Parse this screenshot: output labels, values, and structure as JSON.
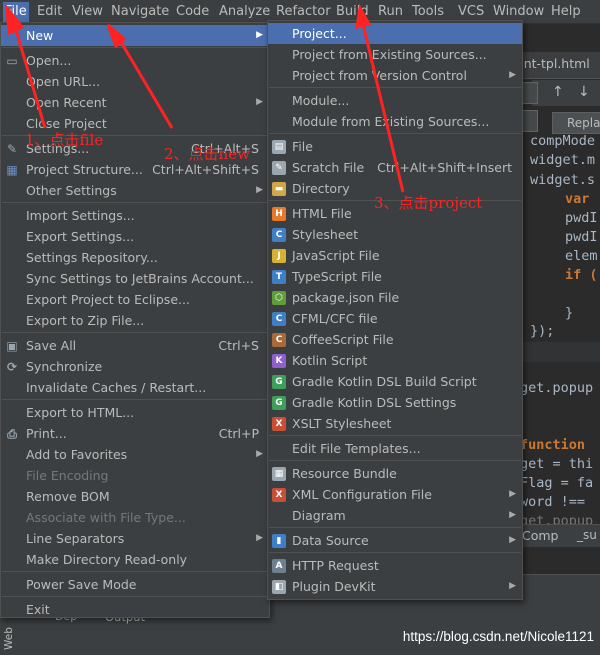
{
  "menubar": {
    "items": [
      "File",
      "Edit",
      "View",
      "Navigate",
      "Code",
      "Analyze",
      "Refactor",
      "Build",
      "Run",
      "Tools",
      "VCS",
      "Window",
      "Help"
    ]
  },
  "editor": {
    "tab_title": "ent-tpl.html",
    "replace_button": "Replac",
    "code_lines": [
      "compMode",
      "widget.m",
      "widget.s",
      "var",
      "pwdI",
      "pwdI",
      "elem",
      "if (",
      "}",
      "});",
      "get.popup",
      "function",
      "get = thi",
      "Flag = fa",
      "word !==",
      "get.popup"
    ],
    "breadcrumb": [
      "Comp",
      "_su"
    ],
    "bottom_panel": {
      "left_label": "Dep",
      "output_label": "Output",
      "side_tab": "Web"
    }
  },
  "file_menu": {
    "items": [
      {
        "label": "New",
        "arrow": true,
        "selected": true
      },
      {
        "label": "Open...",
        "sep_before": true
      },
      {
        "label": "Open URL..."
      },
      {
        "label": "Open Recent",
        "arrow": true
      },
      {
        "label": "Close Project"
      },
      {
        "label": "Settings...",
        "shortcut": "Ctrl+Alt+S",
        "sep_before": true
      },
      {
        "label": "Project Structure...",
        "shortcut": "Ctrl+Alt+Shift+S"
      },
      {
        "label": "Other Settings",
        "arrow": true
      },
      {
        "label": "Import Settings...",
        "sep_before": true
      },
      {
        "label": "Export Settings..."
      },
      {
        "label": "Settings Repository..."
      },
      {
        "label": "Sync Settings to JetBrains Account..."
      },
      {
        "label": "Export Project to Eclipse..."
      },
      {
        "label": "Export to Zip File..."
      },
      {
        "label": "Save All",
        "shortcut": "Ctrl+S",
        "sep_before": true
      },
      {
        "label": "Synchronize"
      },
      {
        "label": "Invalidate Caches / Restart..."
      },
      {
        "label": "Export to HTML...",
        "sep_before": true
      },
      {
        "label": "Print...",
        "shortcut": "Ctrl+P"
      },
      {
        "label": "Add to Favorites",
        "arrow": true
      },
      {
        "label": "File Encoding",
        "disabled": true
      },
      {
        "label": "Remove BOM"
      },
      {
        "label": "Associate with File Type...",
        "disabled": true
      },
      {
        "label": "Line Separators",
        "arrow": true
      },
      {
        "label": "Make Directory Read-only"
      },
      {
        "label": "Power Save Mode",
        "sep_before": true
      },
      {
        "label": "Exit",
        "sep_before": true
      }
    ]
  },
  "new_menu": {
    "items": [
      {
        "label": "Project...",
        "selected": true
      },
      {
        "label": "Project from Existing Sources..."
      },
      {
        "label": "Project from Version Control",
        "arrow": true
      },
      {
        "label": "Module...",
        "sep_before": true
      },
      {
        "label": "Module from Existing Sources..."
      },
      {
        "label": "File",
        "icon": "file-icon",
        "sep_before": true
      },
      {
        "label": "Scratch File",
        "shortcut": "Ctrl+Alt+Shift+Insert",
        "icon": "scratch-file-icon"
      },
      {
        "label": "Directory",
        "icon": "folder-icon"
      },
      {
        "label": "HTML File",
        "icon": "html-file-icon",
        "sep_before": true
      },
      {
        "label": "Stylesheet",
        "icon": "css-file-icon"
      },
      {
        "label": "JavaScript File",
        "icon": "js-file-icon"
      },
      {
        "label": "TypeScript File",
        "icon": "ts-file-icon"
      },
      {
        "label": "package.json File",
        "icon": "nodejs-icon"
      },
      {
        "label": "CFML/CFC file",
        "icon": "cfml-file-icon"
      },
      {
        "label": "CoffeeScript File",
        "icon": "coffeescript-icon"
      },
      {
        "label": "Kotlin Script",
        "icon": "kotlin-icon"
      },
      {
        "label": "Gradle Kotlin DSL Build Script",
        "icon": "gradle-icon"
      },
      {
        "label": "Gradle Kotlin DSL Settings",
        "icon": "gradle-icon"
      },
      {
        "label": "XSLT Stylesheet",
        "icon": "xslt-file-icon"
      },
      {
        "label": "Edit File Templates...",
        "sep_before": true
      },
      {
        "label": "Resource Bundle",
        "icon": "resource-bundle-icon",
        "sep_before": true
      },
      {
        "label": "XML Configuration File",
        "arrow": true,
        "icon": "xml-file-icon"
      },
      {
        "label": "Diagram",
        "arrow": true
      },
      {
        "label": "Data Source",
        "arrow": true,
        "icon": "database-icon",
        "sep_before": true
      },
      {
        "label": "HTTP Request",
        "icon": "api-icon",
        "sep_before": true
      },
      {
        "label": "Plugin DevKit",
        "arrow": true,
        "icon": "plugin-icon"
      }
    ]
  },
  "annotations": {
    "step1": "1、点击file",
    "step2": "2、点击new",
    "step3": "3、点击project"
  },
  "watermark": "https://blog.csdn.net/Nicole1121",
  "colors": {
    "selection": "#4b6eaf",
    "menu_bg": "#3c3f41",
    "annotation": "#ff2222"
  }
}
